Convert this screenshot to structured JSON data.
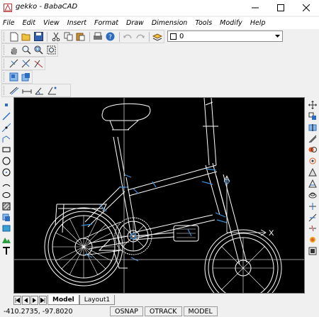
{
  "window": {
    "title": "gekko - BabaCAD"
  },
  "menu": [
    "File",
    "Edit",
    "View",
    "Insert",
    "Format",
    "Draw",
    "Dimension",
    "Tools",
    "Modify",
    "Help"
  ],
  "layer": {
    "selected": "0"
  },
  "tabs": {
    "model": "Model",
    "layout": "Layout1"
  },
  "status": {
    "coords": "-410.2735, -97.8020",
    "osnap": "OSNAP",
    "otrack": "OTRACK",
    "model": "MODEL"
  },
  "canvas": {
    "axis_label": "X"
  },
  "colors": {
    "canvas_bg": "#000000",
    "drawing_lines": "#ffffff",
    "accent_lines": "#3a8fd9"
  }
}
